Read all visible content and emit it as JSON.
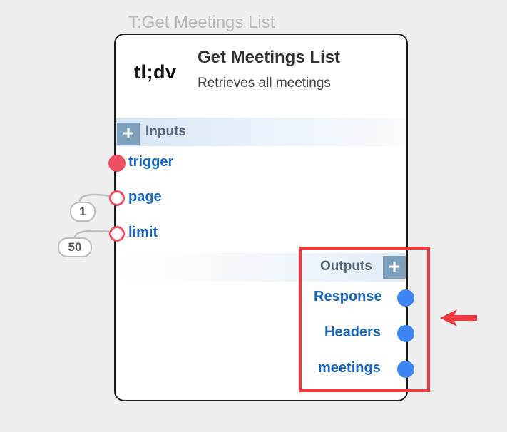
{
  "node": {
    "tag": "T:Get Meetings List",
    "logo": "tl;dv",
    "title": "Get Meetings List",
    "subtitle": "Retrieves all meetings"
  },
  "inputs": {
    "label": "Inputs",
    "add_symbol": "+",
    "ports": [
      {
        "name": "trigger"
      },
      {
        "name": "page",
        "default": "1"
      },
      {
        "name": "limit",
        "default": "50"
      }
    ]
  },
  "outputs": {
    "label": "Outputs",
    "add_symbol": "+",
    "ports": [
      {
        "name": "Response"
      },
      {
        "name": "Headers"
      },
      {
        "name": "meetings"
      }
    ]
  },
  "colors": {
    "port_label": "#1565c0",
    "trigger_port": "#ef4f63",
    "output_port": "#3d86f1",
    "highlight": "#f0393f"
  },
  "icons": {
    "add": "plus-icon",
    "pointer": "arrow-left-icon"
  }
}
